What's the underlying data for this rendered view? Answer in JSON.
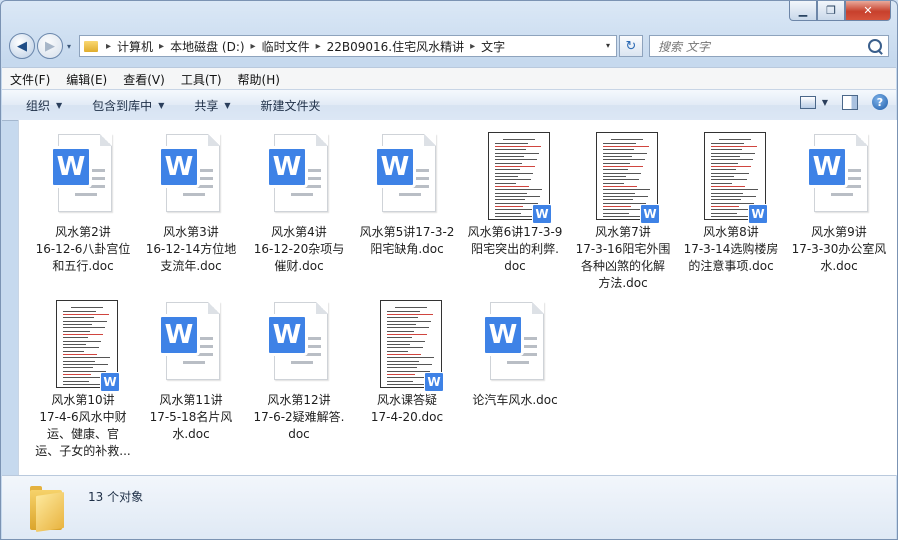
{
  "window": {
    "caption": {
      "minimize": "▁",
      "maximize": "❐",
      "close": "✕"
    }
  },
  "nav": {
    "back": "◀",
    "forward": "▶",
    "dropdown": "▾"
  },
  "address": {
    "crumbs": [
      "计算机",
      "本地磁盘 (D:)",
      "临时文件",
      "22B09016.住宅风水精讲",
      "文字"
    ],
    "separator": "▸"
  },
  "refresh_glyph": "↻",
  "search": {
    "placeholder": "搜索 文字"
  },
  "menu": [
    "文件(F)",
    "编辑(E)",
    "查看(V)",
    "工具(T)",
    "帮助(H)"
  ],
  "toolbar": {
    "organize": "组织",
    "include_in_library": "包含到库中",
    "share": "共享",
    "new_folder": "新建文件夹",
    "help": "?"
  },
  "files": [
    {
      "name": "风水第2讲16-12-6八卦宫位和五行.doc",
      "icon": "word-generic-icon"
    },
    {
      "name": "风水第3讲16-12-14方位地支流年.doc",
      "icon": "word-generic-icon"
    },
    {
      "name": "风水第4讲16-12-20杂项与催财.doc",
      "icon": "word-generic-icon"
    },
    {
      "name": "风水第5讲17-3-2阳宅缺角.doc",
      "icon": "word-generic-icon"
    },
    {
      "name": "风水第6讲17-3-9阳宅突出的利弊.doc",
      "icon": "word-thumbnail-icon"
    },
    {
      "name": "风水第7讲17-3-16阳宅外围各种凶煞的化解方法.doc",
      "icon": "word-thumbnail-icon"
    },
    {
      "name": "风水第8讲17-3-14选购楼房的注意事项.doc",
      "icon": "word-thumbnail-icon"
    },
    {
      "name": "风水第9讲17-3-30办公室风水.doc",
      "icon": "word-generic-icon"
    },
    {
      "name": "风水第10讲17-4-6风水中财运、健康、官运、子女的补救...",
      "icon": "word-thumbnail-icon"
    },
    {
      "name": "风水第11讲17-5-18名片风水.doc",
      "icon": "word-generic-icon"
    },
    {
      "name": "风水第12讲17-6-2疑难解答.doc",
      "icon": "word-generic-icon"
    },
    {
      "name": "风水课答疑17-4-20.doc",
      "icon": "word-thumbnail-icon"
    },
    {
      "name": "论汽车风水.doc",
      "icon": "word-generic-icon"
    }
  ],
  "file_display_lines": [
    [
      "风水第2讲",
      "16-12-6八卦宫位",
      "和五行.doc"
    ],
    [
      "风水第3讲",
      "16-12-14方位地",
      "支流年.doc"
    ],
    [
      "风水第4讲",
      "16-12-20杂项与",
      "催财.doc"
    ],
    [
      "风水第5讲17-3-2",
      "阳宅缺角.doc"
    ],
    [
      "风水第6讲17-3-9",
      "阳宅突出的利弊.",
      "doc"
    ],
    [
      "风水第7讲",
      "17-3-16阳宅外围",
      "各种凶煞的化解",
      "方法.doc"
    ],
    [
      "风水第8讲",
      "17-3-14选购楼房",
      "的注意事项.doc"
    ],
    [
      "风水第9讲",
      "17-3-30办公室风",
      "水.doc"
    ],
    [
      "风水第10讲",
      "17-4-6风水中财",
      "运、健康、官",
      "运、子女的补救..."
    ],
    [
      "风水第11讲",
      "17-5-18名片风",
      "水.doc"
    ],
    [
      "风水第12讲",
      "17-6-2疑难解答.",
      "doc"
    ],
    [
      "风水课答疑",
      "17-4-20.doc"
    ],
    [
      "论汽车风水.doc"
    ]
  ],
  "word_badge_letter": "W",
  "status": {
    "count_text": "13 个对象"
  }
}
